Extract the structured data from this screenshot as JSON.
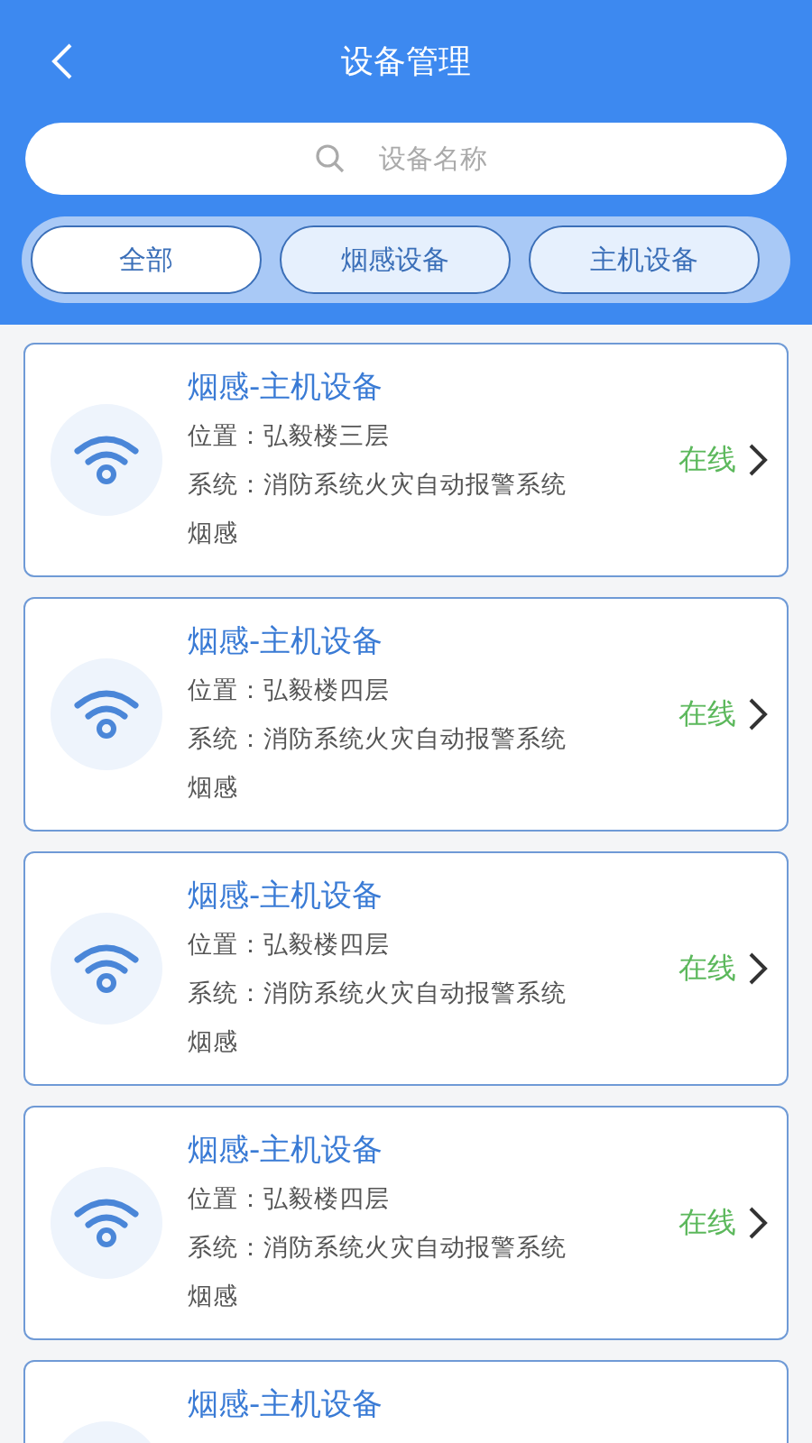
{
  "header": {
    "title": "设备管理",
    "search": {
      "placeholder": "设备名称"
    }
  },
  "tabs": [
    {
      "label": "全部",
      "selected": true
    },
    {
      "label": "烟感设备",
      "selected": false
    },
    {
      "label": "主机设备",
      "selected": false
    }
  ],
  "devices": [
    {
      "name": "烟感-主机设备",
      "location": "位置：弘毅楼三层",
      "system": "系统：消防系统火灾自动报警系统烟感",
      "status": "在线",
      "online": true
    },
    {
      "name": "烟感-主机设备",
      "location": "位置：弘毅楼四层",
      "system": "系统：消防系统火灾自动报警系统烟感",
      "status": "在线",
      "online": true
    },
    {
      "name": "烟感-主机设备",
      "location": "位置：弘毅楼四层",
      "system": "系统：消防系统火灾自动报警系统烟感",
      "status": "在线",
      "online": true
    },
    {
      "name": "烟感-主机设备",
      "location": "位置：弘毅楼四层",
      "system": "系统：消防系统火灾自动报警系统烟感",
      "status": "在线",
      "online": true
    },
    {
      "name": "烟感-主机设备"
    }
  ]
}
